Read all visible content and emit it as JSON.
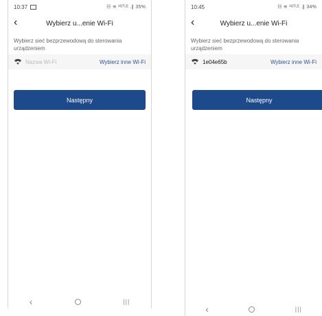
{
  "screens": [
    {
      "status_time": "10:37",
      "status_indicators": "☷ ≋ ³ᴳᵀᴸᴱ .∥ 35%",
      "title": "Wybierz u...enie Wi-Fi",
      "description": "Wybierz sieć bezprzewodową do sterowania urządzeniem",
      "wifi_name": "Nazwa Wi-Fi",
      "wifi_link": "Wybierz inne Wi-Fi",
      "next_button": "Następny"
    },
    {
      "status_time": "10:45",
      "status_indicators": "☷ ≋ ³ᴳᵀᴸᴱ .∥ 34%",
      "title": "Wybierz u...enie Wi-Fi",
      "description": "Wybierz sieć bezprzewodową do sterowania urządzeniem",
      "wifi_name": "1e04e65b",
      "wifi_link": "Wybierz inne Wi-Fi",
      "next_button": "Następny"
    }
  ],
  "icons": {
    "back": "chevron-left-icon",
    "wifi": "wifi-icon",
    "nav_back": "nav-back-icon",
    "nav_home": "nav-home-icon",
    "nav_recent": "nav-recent-icon"
  },
  "colors": {
    "accent": "#1d4a8a",
    "link": "#2d5590",
    "row_background": "#f6f6f6"
  }
}
